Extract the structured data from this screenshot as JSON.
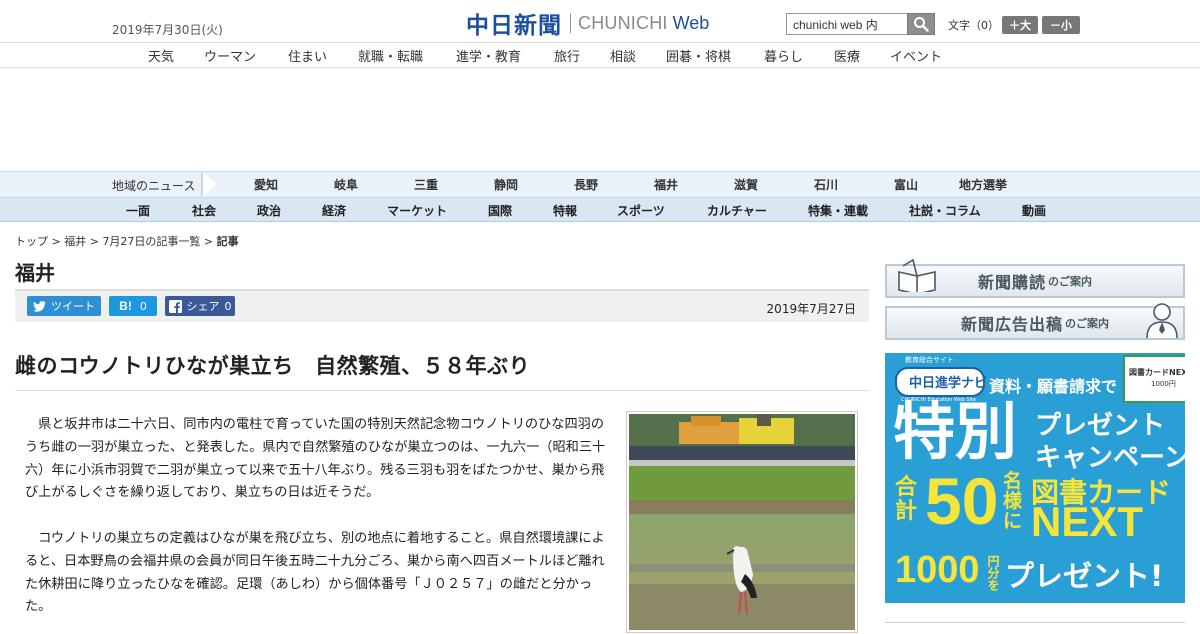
{
  "header": {
    "date": "2019年7月30日(火)",
    "logo_kanji": "中日新聞",
    "logo_latin": "CHUNICHI",
    "logo_web": "Web",
    "search_value": "chunichi web 内",
    "font_label": "文字（0）",
    "font_up": "＋大",
    "font_down": "－小"
  },
  "top_nav": [
    "天気",
    "ウーマン",
    "住まい",
    "就職・転職",
    "進学・教育",
    "旅行",
    "相談",
    "囲碁・将棋",
    "暮らし",
    "医療",
    "イベント"
  ],
  "region_nav": {
    "title": "地域のニュース",
    "items": [
      "愛知",
      "岐阜",
      "三重",
      "静岡",
      "長野",
      "福井",
      "滋賀",
      "石川",
      "富山",
      "地方選挙"
    ]
  },
  "section_nav": [
    "一面",
    "社会",
    "政治",
    "経済",
    "マーケット",
    "国際",
    "特報",
    "スポーツ",
    "カルチャー",
    "特集・連載",
    "社説・コラム",
    "動画"
  ],
  "breadcrumb": {
    "top": "トップ",
    "region": "福井",
    "list": "7月27日の記事一覧",
    "current": "記事",
    "sep": " > "
  },
  "page_title": "福井",
  "share": {
    "tweet": "ツイート",
    "hatena_label": "B!",
    "hatena_count": "0",
    "fb_label": "シェア",
    "fb_count": "0"
  },
  "article": {
    "date": "2019年7月27日",
    "headline": "雌のコウノトリひなが巣立ち　自然繁殖、５８年ぶり",
    "paragraphs": [
      "県と坂井市は二十六日、同市内の電柱で育っていた国の特別天然記念物コウノトリのひな四羽のうち雌の一羽が巣立った、と発表した。県内で自然繁殖のひなが巣立つのは、一九六一（昭和三十六）年に小浜市羽賀で二羽が巣立って以来で五十八年ぶり。残る三羽も羽をばたつかせ、巣から飛び上がるしぐさを繰り返しており、巣立ちの日は近そうだ。",
      "コウノトリの巣立ちの定義はひなが巣を飛び立ち、別の地点に着地すること。県自然環境課によると、日本野鳥の会福井県の会員が同日午後五時二十九分ごろ、巣から南へ四百メートルほど離れた休耕田に降り立ったひなを確認。足環（あしわ）から個体番号「Ｊ０２５７」の雌だと分かった。"
    ]
  },
  "sidebar": {
    "subscribe_main": "新聞購読",
    "subscribe_sub": "のご案内",
    "advertise_main": "新聞広告出稿",
    "advertise_sub": "のご案内",
    "promo": {
      "badge_small": "教育総合サイト",
      "badge": "中日進学ナビ",
      "badge_sub": "CHUNICHI Education Web Site",
      "line1": "資料・願書請求で",
      "big": "特別",
      "campaign1": "プレゼント",
      "campaign2": "キャンペーン",
      "sum1": "合",
      "sum2": "計",
      "count": "50",
      "people1": "名",
      "people2": "様",
      "people3": "に",
      "card_name": "図書カード",
      "next": "NEXT",
      "amount": "1000",
      "yen": "円分を",
      "present": "プレゼント!",
      "card_label": "図書カードNEXT",
      "card_amount": "1000円"
    }
  },
  "colors": {
    "brand_blue": "#1d4fa0",
    "region_bg": "#e9f1f9",
    "section_bg": "#d9e7f5",
    "promo_bg": "#2a9fd6",
    "promo_yellow": "#f5e43a"
  }
}
